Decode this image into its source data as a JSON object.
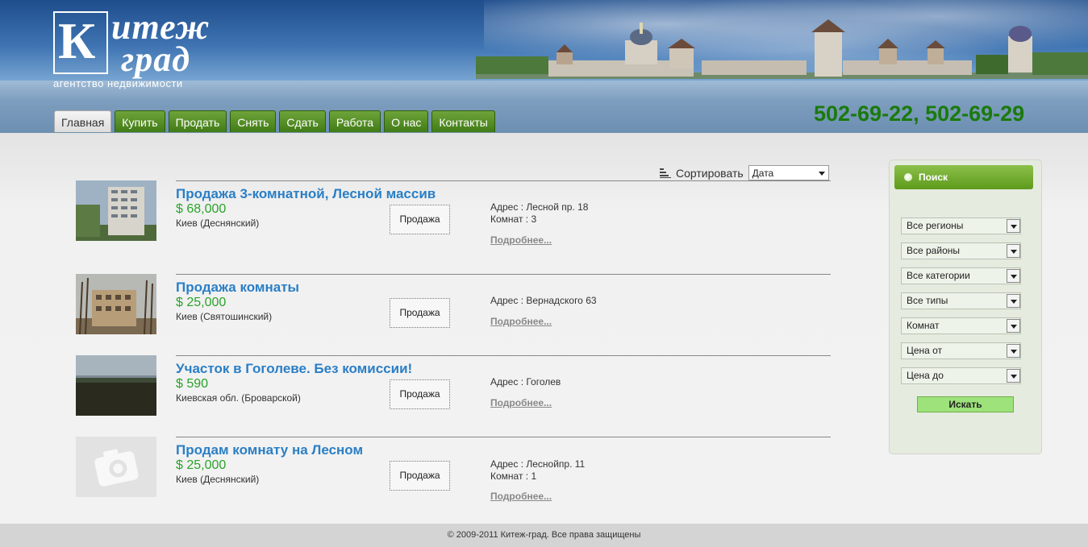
{
  "logo": {
    "letter": "К",
    "line1": "итеж",
    "line2": "град",
    "subtitle": "агентство недвижимости"
  },
  "nav": [
    {
      "label": "Главная",
      "active": true
    },
    {
      "label": "Купить"
    },
    {
      "label": "Продать"
    },
    {
      "label": "Снять"
    },
    {
      "label": "Сдать"
    },
    {
      "label": "Работа"
    },
    {
      "label": "О нас"
    },
    {
      "label": "Контакты"
    }
  ],
  "phones": "502-69-22, 502-69-29",
  "sort": {
    "label": "Сортировать",
    "value": "Дата"
  },
  "listings": [
    {
      "title": "Продажа 3-комнатной, Лесной массив",
      "price": "$ 68,000",
      "location": "Киев (Деснянский)",
      "button": "Продажа",
      "address": "Адрес : Лесной пр. 18",
      "rooms": "Комнат : 3",
      "more": "Подробнее..."
    },
    {
      "title": "Продажа комнаты",
      "price": "$ 25,000",
      "location": "Киев (Святошинский)",
      "button": "Продажа",
      "address": "Адрес : Вернадского 63",
      "rooms": "",
      "more": "Подробнее..."
    },
    {
      "title": "Участок в Гоголеве. Без комиссии!",
      "price": "$ 590",
      "location": "Киевская обл. (Броварской)",
      "button": "Продажа",
      "address": "Адрес : Гоголев",
      "rooms": "",
      "more": "Подробнее..."
    },
    {
      "title": "Продам комнату на Лесном",
      "price": "$ 25,000",
      "location": "Киев (Деснянский)",
      "button": "Продажа",
      "address": "Адрес : Леснойпр. 11",
      "rooms": "Комнат : 1",
      "more": "Подробнее..."
    }
  ],
  "search": {
    "title": "Поиск",
    "selects": [
      "Все регионы",
      "Все районы",
      "Все категории",
      "Все типы",
      "Комнат",
      "Цена от",
      "Цена до"
    ],
    "button": "Искать"
  },
  "footer": "© 2009-2011 Китеж-град. Все права защищены",
  "colors": {
    "nav_green": "#4f8a22",
    "phone_green": "#1a7a0c",
    "title_blue": "#2a7fc6",
    "price_green": "#2aa32a"
  }
}
